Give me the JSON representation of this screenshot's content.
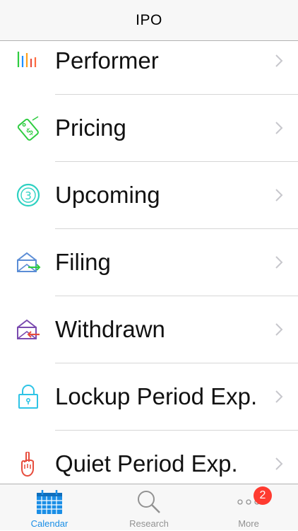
{
  "nav": {
    "title": "IPO"
  },
  "list": {
    "items": [
      {
        "label": "Performer",
        "icon": "bar-chart-icon"
      },
      {
        "label": "Pricing",
        "icon": "price-tag-icon"
      },
      {
        "label": "Upcoming",
        "icon": "number-3-circle-icon"
      },
      {
        "label": "Filing",
        "icon": "envelope-in-icon"
      },
      {
        "label": "Withdrawn",
        "icon": "envelope-out-icon"
      },
      {
        "label": "Lockup Period Exp.",
        "icon": "lock-icon"
      },
      {
        "label": "Quiet Period Exp.",
        "icon": "shush-hand-icon"
      }
    ]
  },
  "tabbar": {
    "tabs": [
      {
        "label": "Calendar",
        "icon": "calendar-icon",
        "selected": true
      },
      {
        "label": "Research",
        "icon": "magnifier-icon",
        "selected": false
      },
      {
        "label": "More",
        "icon": "more-dots-icon",
        "selected": false,
        "badge": "2"
      }
    ]
  },
  "colors": {
    "accent": "#1a8ee6",
    "tab_inactive": "#929292",
    "badge": "#ff3b30",
    "separator": "#d6d6d6"
  }
}
